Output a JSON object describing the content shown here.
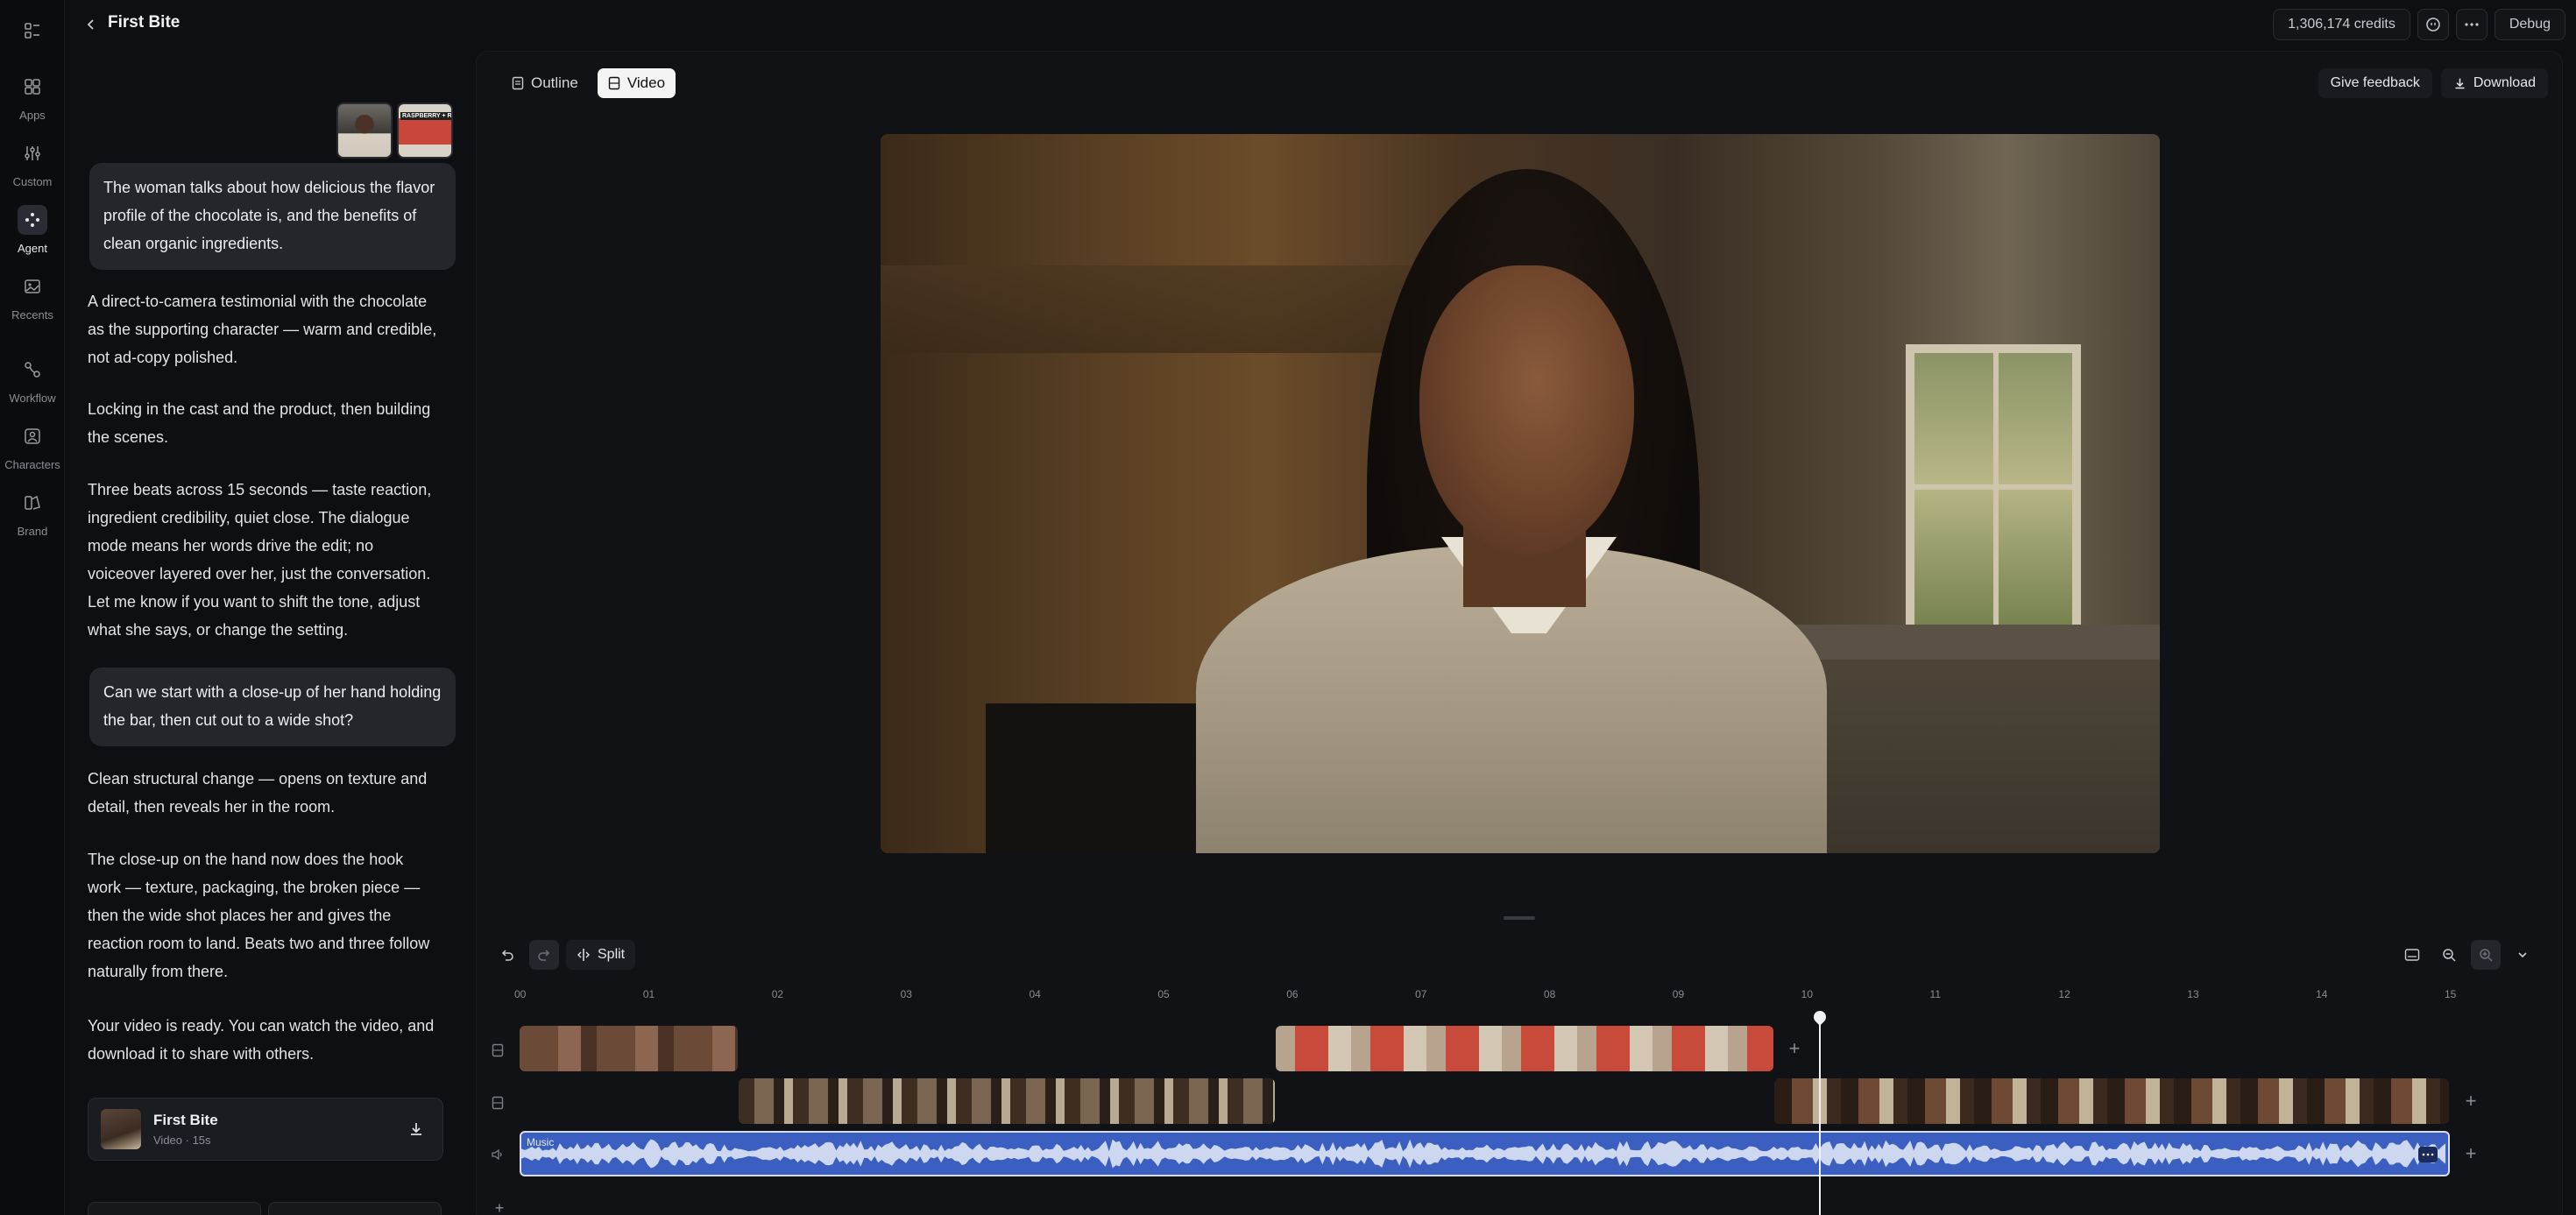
{
  "header": {
    "project_title": "First Bite",
    "credits": "1,306,174 credits",
    "debug_label": "Debug"
  },
  "rail": {
    "items": [
      {
        "label": "Apps",
        "icon": "grid-icon"
      },
      {
        "label": "Custom",
        "icon": "sliders-icon"
      },
      {
        "label": "Agent",
        "icon": "agent-icon",
        "active": true
      },
      {
        "label": "Recents",
        "icon": "image-icon"
      },
      {
        "label": "Workflow",
        "icon": "workflow-icon"
      },
      {
        "label": "Characters",
        "icon": "characters-icon"
      },
      {
        "label": "Brand",
        "icon": "brand-icon"
      }
    ]
  },
  "chat": {
    "user_message_1": "The woman talks about how delicious the flavor profile of the chocolate is, and the benefits of clean organic ingredients.",
    "thumb_label": "RASPBERRY + ROSE",
    "reply_1": "A direct-to-camera testimonial with the chocolate as the supporting character — warm and credible, not ad-copy polished.",
    "reply_2": "Locking in the cast and the product, then building the scenes.",
    "reply_3": "Three beats across 15 seconds — taste reaction, ingredient credibility, quiet close. The dialogue mode means her words drive the edit; no voiceover layered over her, just the conversation. Let me know if you want to shift the tone, adjust what she says, or change the setting.",
    "user_message_2": "Can we start with a close-up of her hand holding the bar, then cut out to a wide shot?",
    "reply_4": "Clean structural change — opens on texture and detail, then reveals her in the room.",
    "reply_5": "The close-up on the hand now does the hook work — texture, packaging, the broken piece — then the wide shot places her and gives the reaction room to land. Beats two and three follow naturally from there.",
    "reply_6": "Your video is ready. You can watch the video, and download it to share with others.",
    "file_card": {
      "title": "First Bite",
      "subtitle": "Video · 15s"
    }
  },
  "main": {
    "tabs": [
      {
        "label": "Outline",
        "active": false
      },
      {
        "label": "Video",
        "active": true
      }
    ],
    "give_feedback": "Give feedback",
    "download": "Download"
  },
  "timeline": {
    "split_label": "Split",
    "ticks": [
      "00",
      "01",
      "02",
      "03",
      "04",
      "05",
      "06",
      "07",
      "08",
      "09",
      "10",
      "11",
      "12",
      "13",
      "14",
      "15"
    ],
    "playhead_seconds": 10.1,
    "music_label": "Music"
  }
}
